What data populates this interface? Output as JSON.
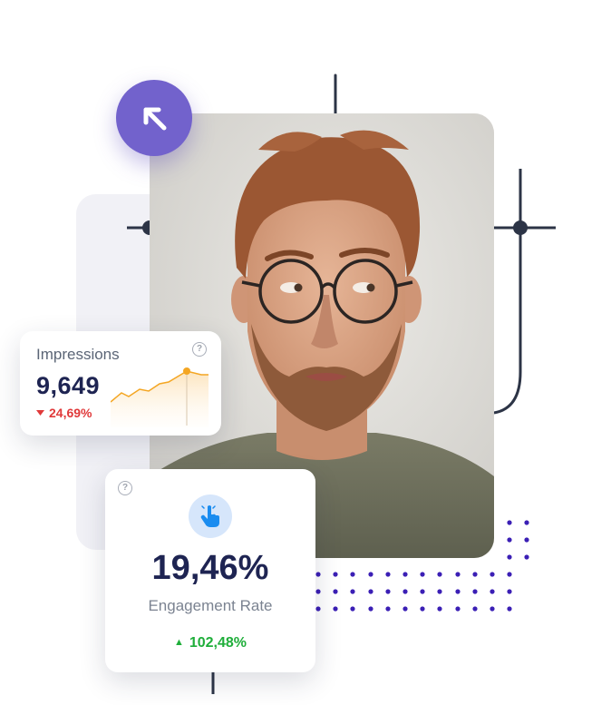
{
  "impressions_card": {
    "title": "Impressions",
    "value": "9,649",
    "change": "24,69%",
    "change_direction": "down",
    "change_color": "#e0393a",
    "help_icon": "question-circle-icon"
  },
  "engagement_card": {
    "value": "19,46%",
    "label": "Engagement Rate",
    "change": "102,48%",
    "change_direction": "up",
    "change_color": "#1fae3a",
    "icon": "hand-pointer-icon",
    "help_icon": "question-circle-icon"
  },
  "arrow_badge": {
    "icon": "arrow-up-left-icon",
    "color": "#7262cc"
  },
  "colors": {
    "navy": "#1e2452",
    "accent_purple": "#7262cc",
    "dot_color": "#3b1fb5",
    "line_color": "#2c3446",
    "sparkline_stroke": "#f4a623"
  }
}
